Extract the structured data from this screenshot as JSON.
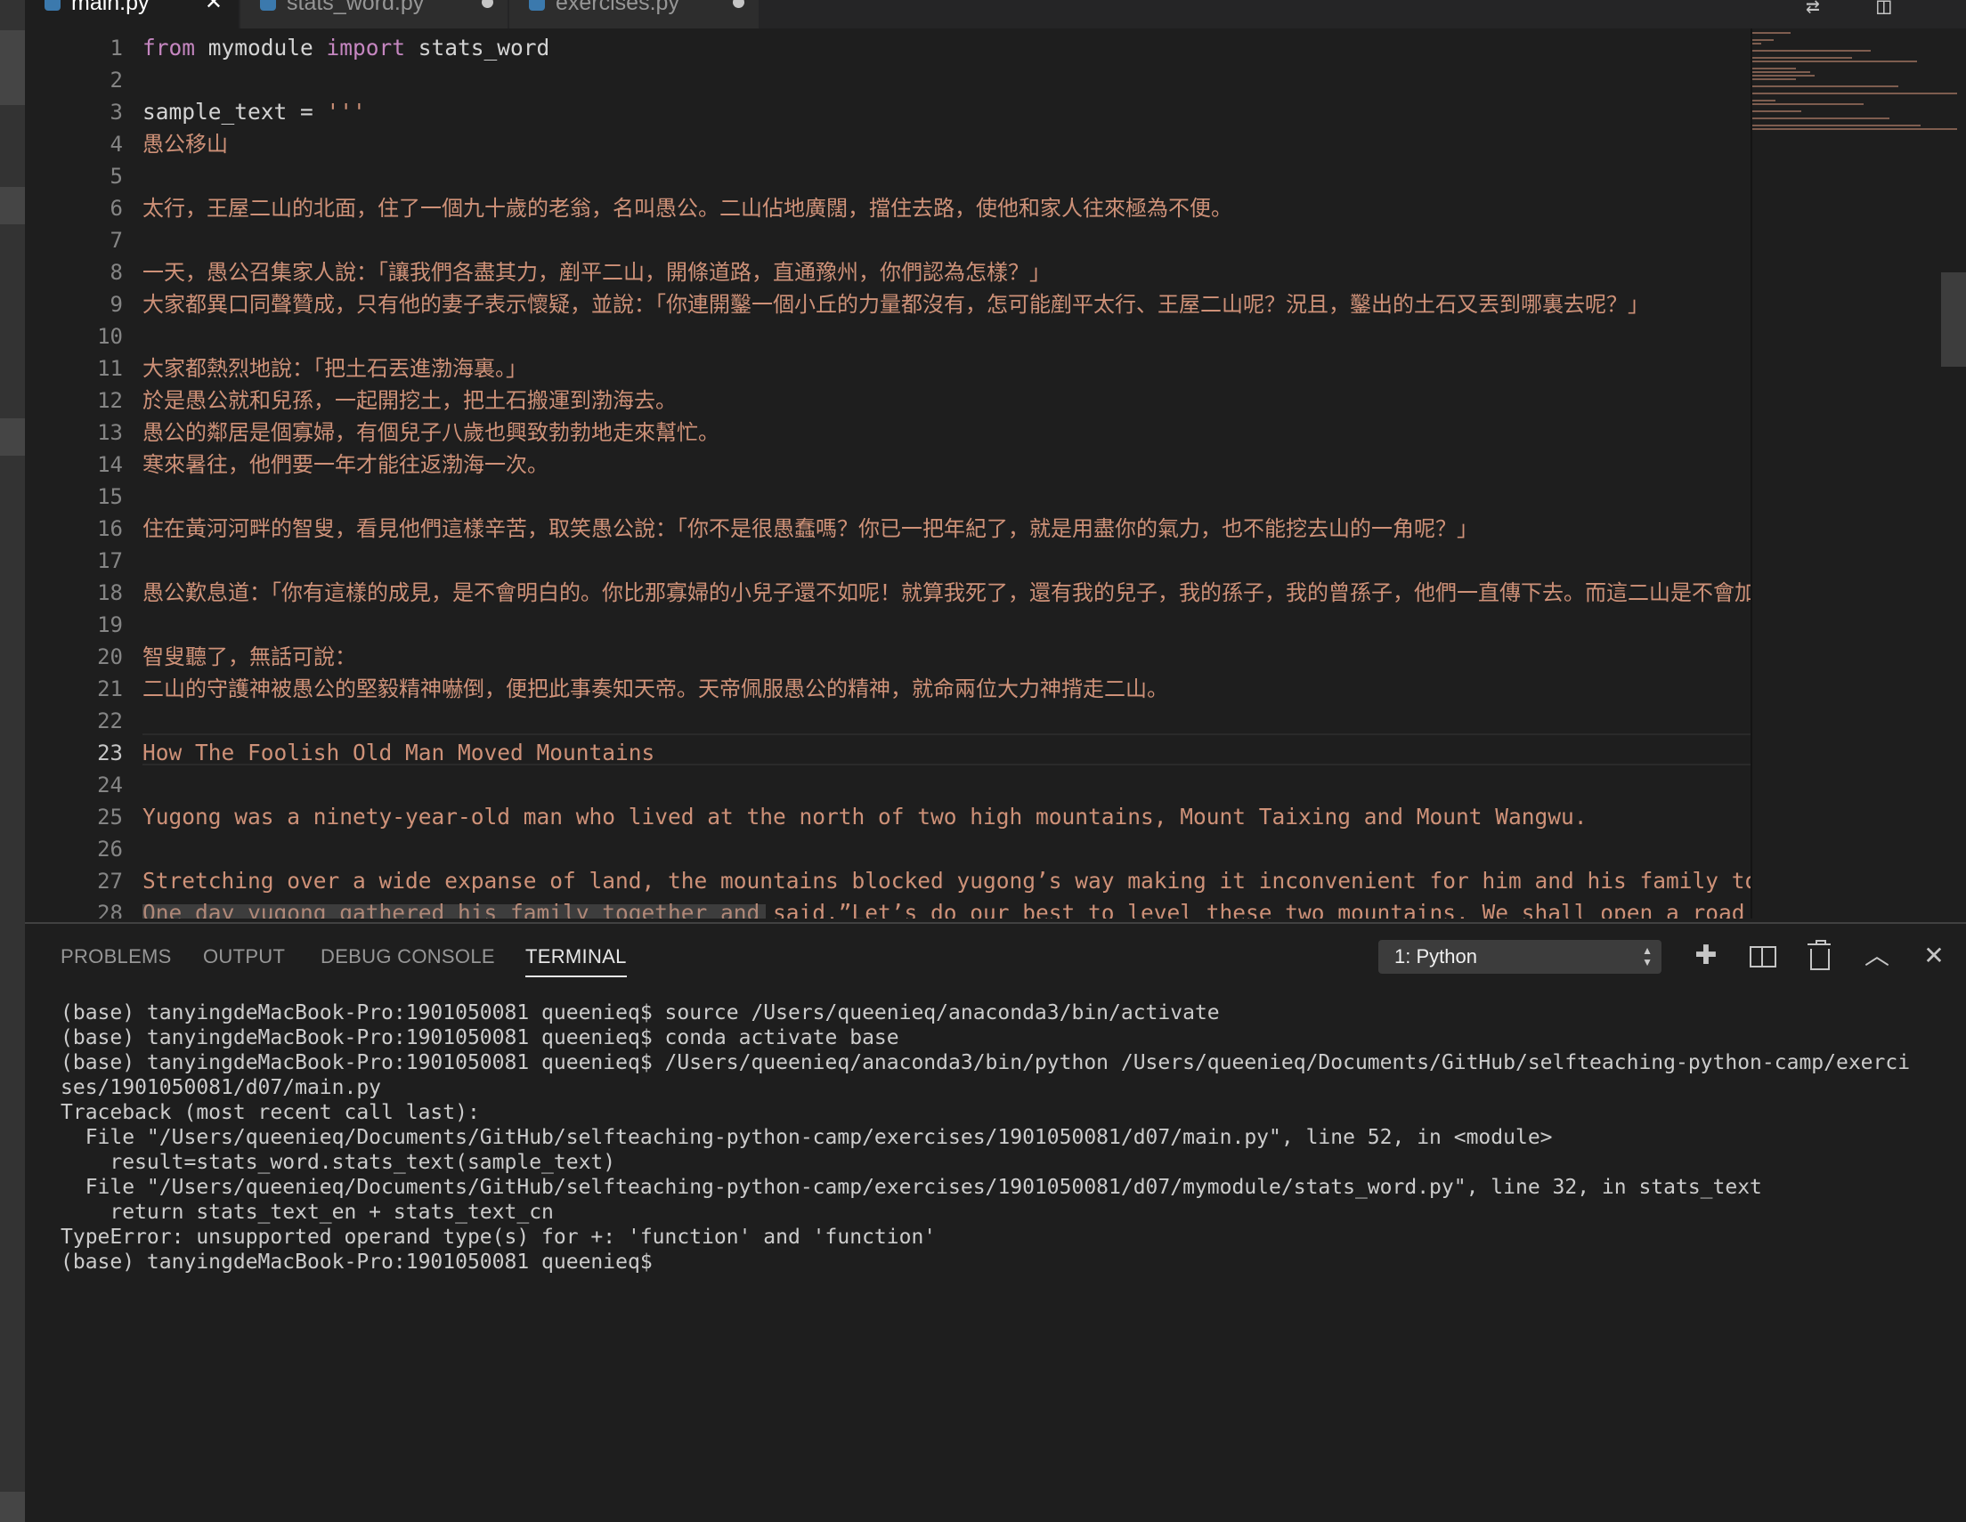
{
  "tabs": [
    {
      "name": "main.py",
      "state": "close"
    },
    {
      "name": "stats_word.py",
      "state": "dirty"
    },
    {
      "name": "exercises.py",
      "state": "dirty"
    }
  ],
  "tab_actions": [
    {
      "icon": "compare-changes-icon",
      "glyph": "⇄"
    },
    {
      "icon": "split-editor-icon",
      "glyph": "◫"
    }
  ],
  "editor": {
    "current_line": 23,
    "line_numbers": [
      "1",
      "2",
      "3",
      "4",
      "5",
      "6",
      "7",
      "8",
      "9",
      "10",
      "11",
      "12",
      "13",
      "14",
      "15",
      "16",
      "17",
      "18",
      "19",
      "20",
      "21",
      "22",
      "23",
      "24",
      "25",
      "26",
      "27",
      "28"
    ],
    "lines": [
      {
        "kind": "code",
        "parts": [
          {
            "t": "from",
            "c": "kw"
          },
          {
            "t": " mymodule ",
            "c": "plain"
          },
          {
            "t": "import",
            "c": "kw"
          },
          {
            "t": " stats_word",
            "c": "plain"
          }
        ]
      },
      {
        "kind": "blank",
        "text": ""
      },
      {
        "kind": "code",
        "parts": [
          {
            "t": "sample_text = ",
            "c": "plain"
          },
          {
            "t": "'''",
            "c": "str"
          }
        ]
      },
      {
        "kind": "cjk",
        "text": "愚公移山"
      },
      {
        "kind": "blank",
        "text": ""
      },
      {
        "kind": "cjk",
        "text": "太行，王屋二山的北面，住了一個九十歲的老翁，名叫愚公。二山佔地廣闊，擋住去路，使他和家人往來極為不便。"
      },
      {
        "kind": "blank",
        "text": ""
      },
      {
        "kind": "cjk",
        "text": "一天，愚公召集家人說：「讓我們各盡其力，剷平二山，開條道路，直通豫州，你們認為怎樣？」"
      },
      {
        "kind": "cjk",
        "text": "大家都異口同聲贊成，只有他的妻子表示懷疑，並說：「你連開鑿一個小丘的力量都沒有，怎可能剷平太行、王屋二山呢？況且，鑿出的土石又丟到哪裏去呢？」"
      },
      {
        "kind": "blank",
        "text": ""
      },
      {
        "kind": "cjk",
        "text": "大家都熱烈地說：「把土石丟進渤海裏。」"
      },
      {
        "kind": "cjk",
        "text": "於是愚公就和兒孫，一起開挖土，把土石搬運到渤海去。"
      },
      {
        "kind": "cjk",
        "text": "愚公的鄰居是個寡婦，有個兒子八歲也興致勃勃地走來幫忙。"
      },
      {
        "kind": "cjk",
        "text": "寒來暑往，他們要一年才能往返渤海一次。"
      },
      {
        "kind": "blank",
        "text": ""
      },
      {
        "kind": "cjk",
        "text": "住在黃河河畔的智叟，看見他們這樣辛苦，取笑愚公說：「你不是很愚蠢嗎？你已一把年紀了，就是用盡你的氣力，也不能挖去山的一角呢？」"
      },
      {
        "kind": "blank",
        "text": ""
      },
      {
        "kind": "cjk",
        "text": "愚公歎息道：「你有這樣的成見，是不會明白的。你比那寡婦的小兒子還不如呢！就算我死了，還有我的兒子，我的孫子，我的曾孫子，他們一直傳下去。而這二山是不會加大的，總有一天，我們會把它們剷平。」"
      },
      {
        "kind": "blank",
        "text": ""
      },
      {
        "kind": "cjk",
        "text": "智叟聽了，無話可說："
      },
      {
        "kind": "cjk",
        "text": "二山的守護神被愚公的堅毅精神嚇倒，便把此事奏知天帝。天帝佩服愚公的精神，就命兩位大力神揹走二山。"
      },
      {
        "kind": "blank",
        "text": ""
      },
      {
        "kind": "str",
        "text": "How The Foolish Old Man Moved Mountains"
      },
      {
        "kind": "blank",
        "text": ""
      },
      {
        "kind": "str",
        "text": "Yugong was a ninety-year-old man who lived at the north of two high mountains, Mount Taixing and Mount Wangwu."
      },
      {
        "kind": "blank",
        "text": ""
      },
      {
        "kind": "str",
        "text": "Stretching over a wide expanse of land, the mountains blocked yugong’s way making it inconvenient for him and his family to get around."
      },
      {
        "kind": "str",
        "text": "One day yugong gathered his family together and said,”Let’s do our best to level these two mountains. We shall open a road that leads to Yuzhou. What do you think?”"
      }
    ]
  },
  "panel": {
    "tabs": [
      "PROBLEMS",
      "OUTPUT",
      "DEBUG CONSOLE",
      "TERMINAL"
    ],
    "active_tab": "TERMINAL",
    "terminal_select": "1: Python",
    "terminal_lines": [
      "(base) tanyingdeMacBook-Pro:1901050081 queenieq$ source /Users/queenieq/anaconda3/bin/activate",
      "(base) tanyingdeMacBook-Pro:1901050081 queenieq$ conda activate base",
      "(base) tanyingdeMacBook-Pro:1901050081 queenieq$ /Users/queenieq/anaconda3/bin/python /Users/queenieq/Documents/GitHub/selfteaching-python-camp/exerci",
      "ses/1901050081/d07/main.py",
      "Traceback (most recent call last):",
      "  File \"/Users/queenieq/Documents/GitHub/selfteaching-python-camp/exercises/1901050081/d07/main.py\", line 52, in <module>",
      "    result=stats_word.stats_text(sample_text)",
      "  File \"/Users/queenieq/Documents/GitHub/selfteaching-python-camp/exercises/1901050081/d07/mymodule/stats_word.py\", line 32, in stats_text",
      "    return stats_text_en + stats_text_cn",
      "TypeError: unsupported operand type(s) for +: 'function' and 'function'",
      "(base) tanyingdeMacBook-Pro:1901050081 queenieq$"
    ]
  },
  "colors": {
    "keyword": "#c586c0",
    "string": "#ce9178",
    "plain": "#d4d4d4",
    "line_number": "#858585",
    "background": "#1e1e1e"
  }
}
